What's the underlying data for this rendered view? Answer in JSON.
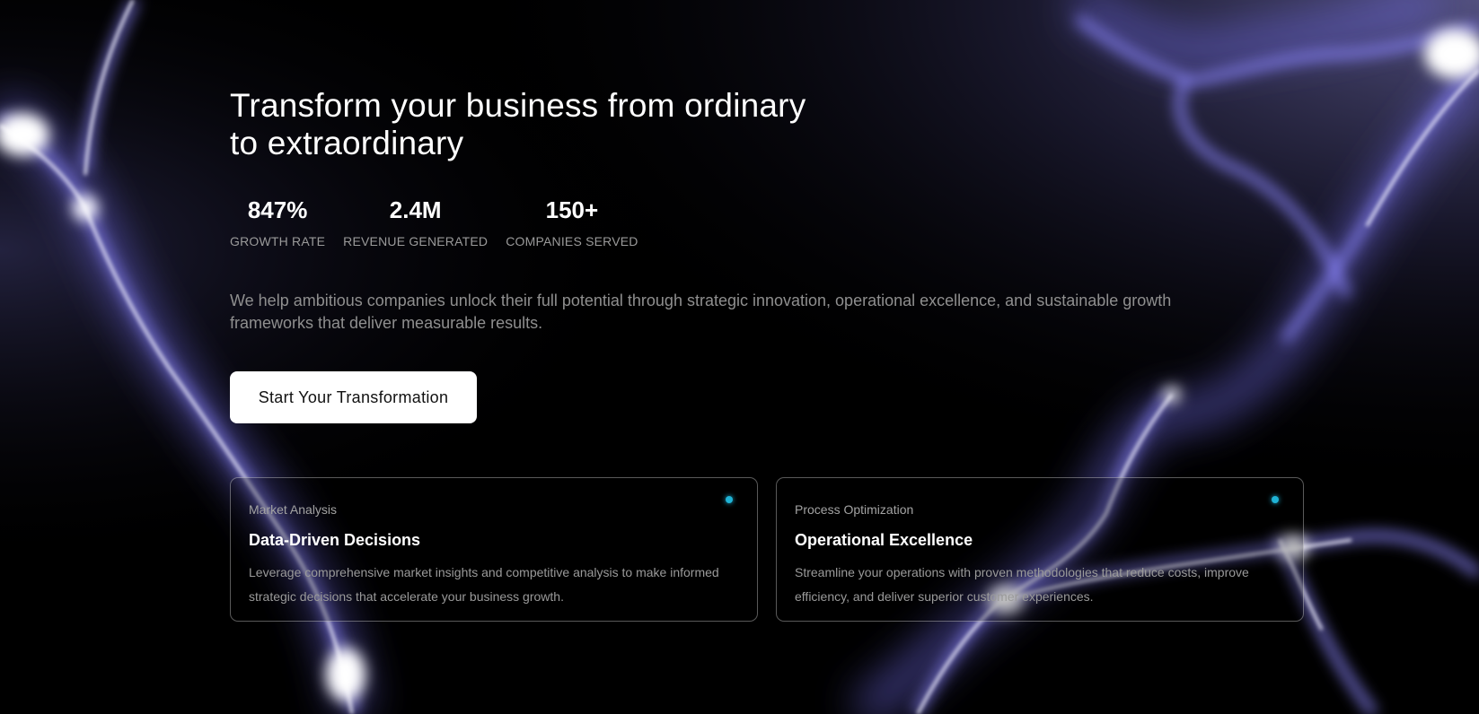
{
  "hero": {
    "headline_line1": "Transform your business from ordinary",
    "headline_line2": "to extraordinary",
    "description": "We help ambitious companies unlock their full potential through strategic innovation, operational excellence, and sustainable growth frameworks that deliver measurable results.",
    "cta_label": "Start Your Transformation"
  },
  "stats": [
    {
      "value": "847%",
      "label": "GROWTH RATE"
    },
    {
      "value": "2.4M",
      "label": "REVENUE GENERATED"
    },
    {
      "value": "150+",
      "label": "COMPANIES SERVED"
    }
  ],
  "cards": [
    {
      "eyebrow": "Market Analysis",
      "title": "Data-Driven Decisions",
      "body": "Leverage comprehensive market insights and competitive analysis to make informed strategic decisions that accelerate your business growth."
    },
    {
      "eyebrow": "Process Optimization",
      "title": "Operational Excellence",
      "body": "Streamline your operations with proven methodologies that reduce costs, improve efficiency, and deliver superior customer experiences."
    }
  ],
  "colors": {
    "background": "#000000",
    "glow": "#8f88ff",
    "accent_dot": "#1fb3d6",
    "button_bg": "#ffffff"
  }
}
